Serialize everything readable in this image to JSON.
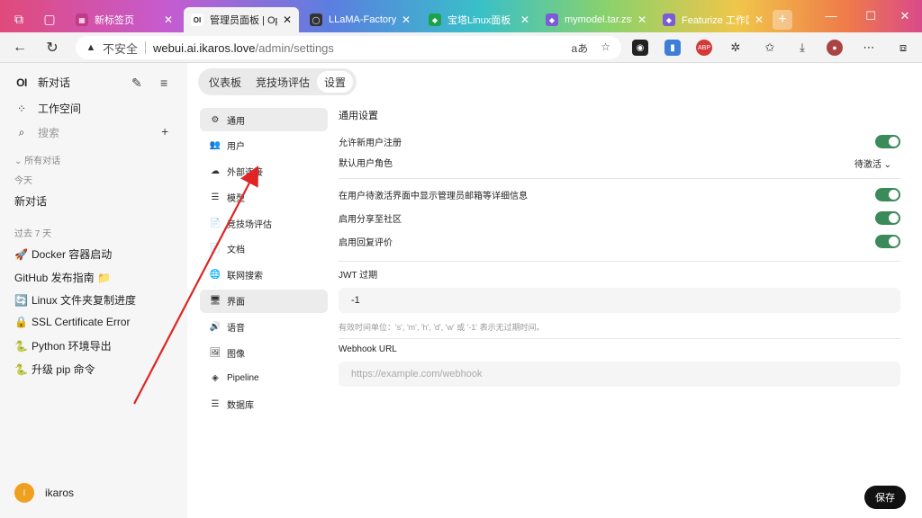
{
  "browser": {
    "tabs": [
      {
        "title": "新标签页",
        "fav_color": "#c23a8a",
        "fav_glyph": "▦"
      },
      {
        "title": "管理员面板 | Open",
        "fav_color": "#222222",
        "fav_glyph": "OI"
      },
      {
        "title": "LLaMA-Factory/dat",
        "fav_color": "#333333",
        "fav_glyph": "◯"
      },
      {
        "title": "宝塔Linux面板",
        "fav_color": "#1aa34a",
        "fav_glyph": "◆"
      },
      {
        "title": "mymodel.tar.zst",
        "fav_color": "#7b5cd6",
        "fav_glyph": "◆"
      },
      {
        "title": "Featurize 工作区",
        "fav_color": "#7b5cd6",
        "fav_glyph": "◆"
      }
    ],
    "insecure_label": "不安全",
    "url_host": "webui.ai.ikaros.love",
    "url_path": "/admin/settings",
    "read_aloud": "aあ"
  },
  "sidebar": {
    "new_chat": "新对话",
    "workspace": "工作空间",
    "search": "搜索",
    "all_chats": "所有对话",
    "today": "今天",
    "today_items": [
      "新对话"
    ],
    "last7": "过去 7 天",
    "last7_items": [
      {
        "emoji": "🚀",
        "text": "Docker 容器启动"
      },
      {
        "emoji": "",
        "text": "GitHub 发布指南 📁"
      },
      {
        "emoji": "🔄",
        "text": "Linux 文件夹复制进度"
      },
      {
        "emoji": "🔒",
        "text": "SSL Certificate Error"
      },
      {
        "emoji": "🐍",
        "text": "Python 环境导出"
      },
      {
        "emoji": "🐍",
        "text": "升级 pip 命令"
      }
    ],
    "user_initial": "I",
    "user_name": "ikaros"
  },
  "top_tabs": [
    "仪表板",
    "竞技场评估",
    "设置"
  ],
  "settings_nav": [
    {
      "icon": "⚙",
      "label": "通用",
      "name": "general"
    },
    {
      "icon": "👥",
      "label": "用户",
      "name": "users"
    },
    {
      "icon": "☁",
      "label": "外部连接",
      "name": "connections"
    },
    {
      "icon": "☰",
      "label": "模型",
      "name": "models"
    },
    {
      "icon": "📄",
      "label": "竞技场评估",
      "name": "evaluations"
    },
    {
      "icon": "📄",
      "label": "文档",
      "name": "documents"
    },
    {
      "icon": "🌐",
      "label": "联网搜索",
      "name": "web-search"
    },
    {
      "icon": "🖥",
      "label": "界面",
      "name": "interface"
    },
    {
      "icon": "🔊",
      "label": "语音",
      "name": "audio"
    },
    {
      "icon": "🖼",
      "label": "图像",
      "name": "images"
    },
    {
      "icon": "◈",
      "label": "Pipeline",
      "name": "pipeline"
    },
    {
      "icon": "☰",
      "label": "数据库",
      "name": "database"
    }
  ],
  "general": {
    "title": "通用设置",
    "allow_signup": "允许新用户注册",
    "default_role": "默认用户角色",
    "default_role_value": "待激活",
    "show_admin_details": "在用户待激活界面中显示管理员邮箱等详细信息",
    "enable_community_share": "启用分享至社区",
    "enable_rating": "启用回复评价",
    "jwt_label": "JWT 过期",
    "jwt_value": "-1",
    "jwt_hint": "有效时间单位：'s', 'm', 'h', 'd', 'w' 或 '-1' 表示无过期时间。",
    "webhook_label": "Webhook URL",
    "webhook_placeholder": "https://example.com/webhook"
  },
  "save_label": "保存"
}
